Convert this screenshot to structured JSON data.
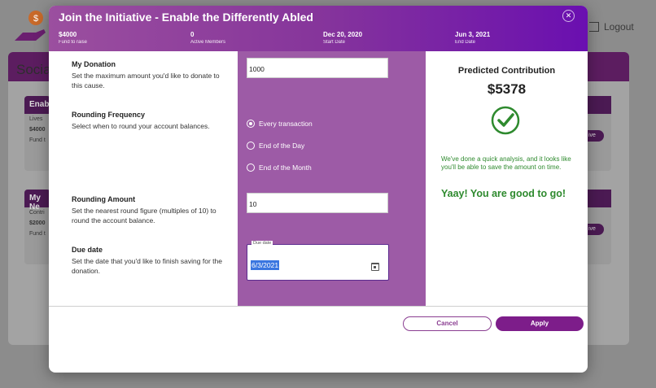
{
  "background": {
    "logout_label": "Logout",
    "section_title": "Social",
    "cards": [
      {
        "title": "Enabl",
        "line1": "Lives",
        "amount": "$4000",
        "caption": "Fund t",
        "action": "ive"
      },
      {
        "title": "My Ne",
        "line1": "Contri",
        "amount": "$2000",
        "caption": "Fund t",
        "action": "ive"
      }
    ]
  },
  "modal": {
    "title": "Join the Initiative - Enable the Differently Abled",
    "close_icon": "close-icon",
    "stats": [
      {
        "value": "$4000",
        "label": "Fund to raise"
      },
      {
        "value": "0",
        "label": "Active Members"
      },
      {
        "value": "Dec 20, 2020",
        "label": "Start Date"
      },
      {
        "value": "Jun 3, 2021",
        "label": "End Date"
      }
    ],
    "donation": {
      "title": "My Donation",
      "desc": "Set the maximum amount you'd like to donate to this cause.",
      "value": "1000"
    },
    "rounding_frequency": {
      "title": "Rounding Frequency",
      "desc": "Select when to round your account balances.",
      "options": [
        "Every transaction",
        "End of the Day",
        "End of the Month"
      ],
      "selected": "Every transaction"
    },
    "rounding_amount": {
      "title": "Rounding Amount",
      "desc": "Set the nearest round figure (multiples of 10) to round the account balance.",
      "value": "10"
    },
    "due_date": {
      "title": "Due date",
      "desc": "Set the date that you'd like to finish saving for the donation.",
      "field_label": "Due date",
      "value": "6/3/2021"
    },
    "prediction": {
      "title": "Predicted Contribution",
      "value": "$5378",
      "analysis": "We've done a quick analysis, and it looks like you'll be able to save the amount on time.",
      "status": "Yaay! You are good to go!"
    },
    "buttons": {
      "cancel": "Cancel",
      "apply": "Apply"
    },
    "colors": {
      "accent": "#7d1d8a",
      "panel": "#9d5ba6",
      "success": "#2e8a2e"
    }
  }
}
